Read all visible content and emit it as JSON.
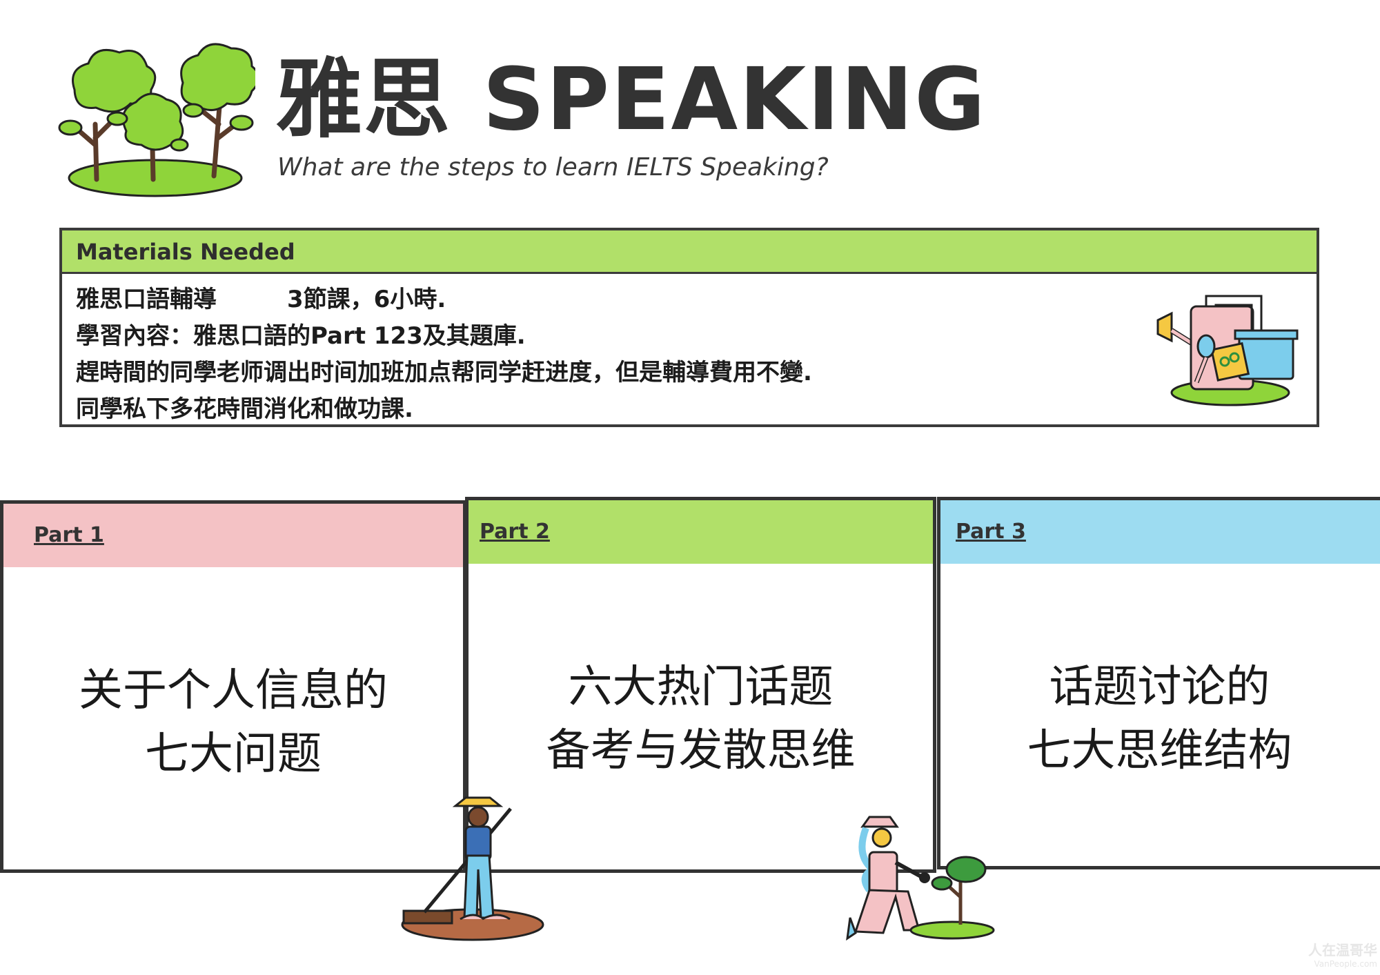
{
  "header": {
    "title": "雅思 SPEAKING",
    "subtitle": "What are the steps to learn IELTS Speaking?"
  },
  "materials": {
    "title": "Materials Needed",
    "lines": [
      "雅思口語輔導　　　3節課，6小時.",
      "學習內容：雅思口語的Part 123及其題庫.",
      "趕時間的同學老师调出时间加班加点帮同学赶进度，但是輔導費用不變.",
      "同學私下多花時間消化和做功課."
    ]
  },
  "parts": [
    {
      "label": "Part 1",
      "line1": "关于个人信息的",
      "line2": "七大问题",
      "color": "#f4c2c5"
    },
    {
      "label": "Part 2",
      "line1": "六大热门话题",
      "line2": "备考与发散思维",
      "color": "#b1e069"
    },
    {
      "label": "Part 3",
      "line1": "话题讨论的",
      "line2": "七大思维结构",
      "color": "#9ddcf1"
    }
  ],
  "watermark": {
    "line1": "人在温哥华",
    "line2": "VanPeople.com"
  },
  "icons": [
    "tree-illustration",
    "watering-can-illustration",
    "farmer-rake-illustration",
    "gardener-illustration"
  ]
}
